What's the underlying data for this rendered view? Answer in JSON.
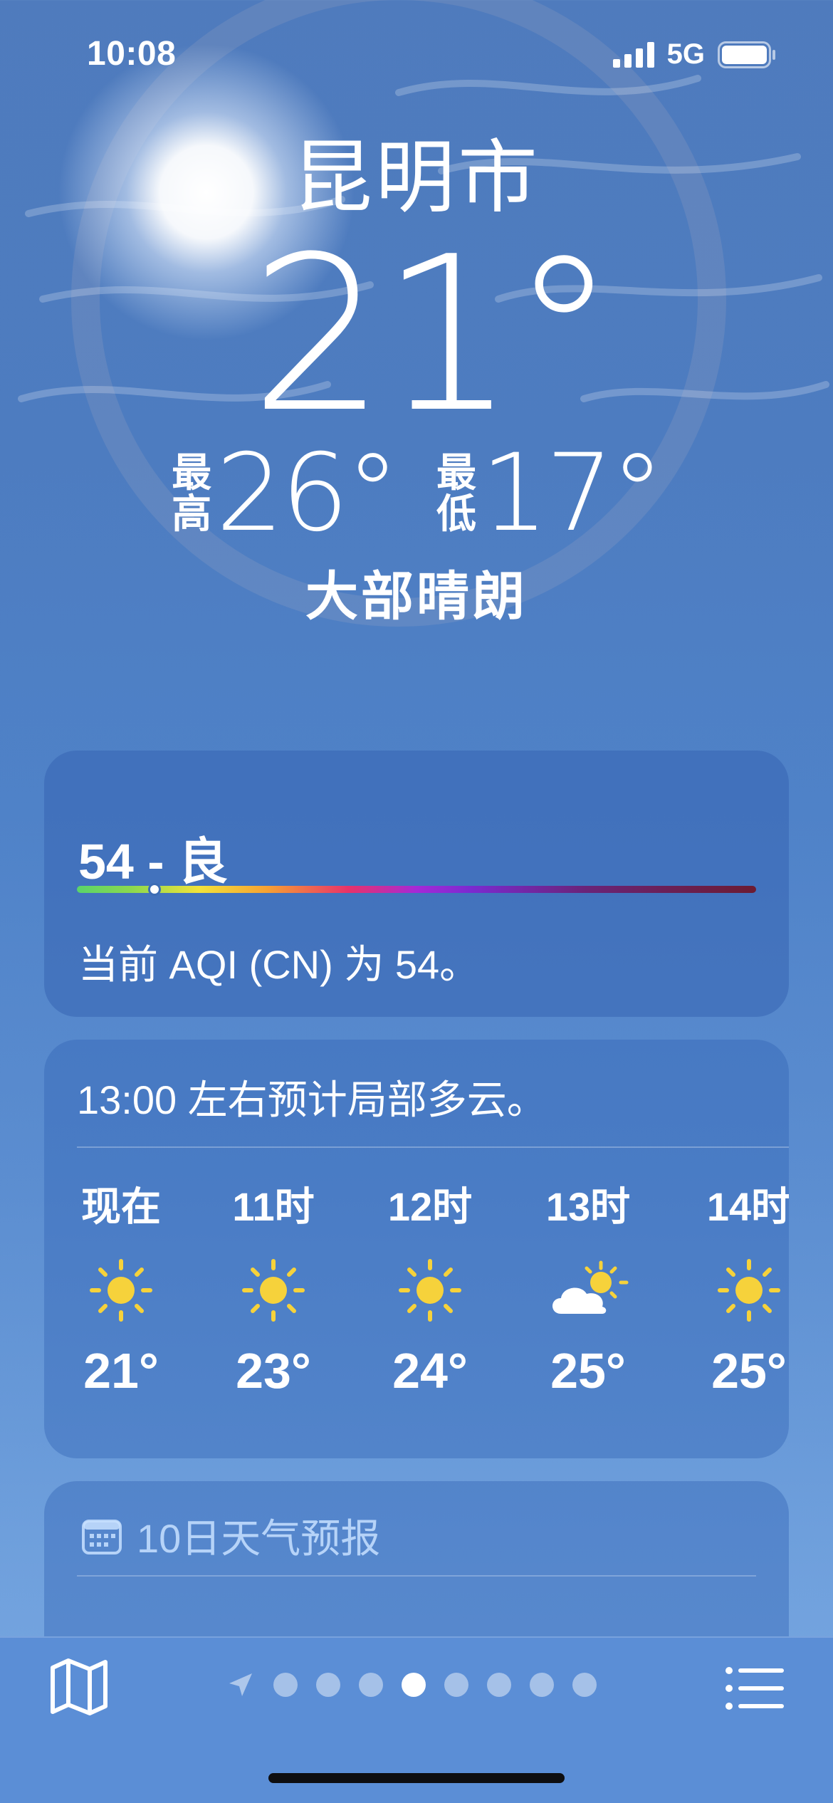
{
  "status_bar": {
    "time": "10:08",
    "network": "5G"
  },
  "weather": {
    "city": "昆明市",
    "current_temp": "21°",
    "high_label": [
      "最",
      "高"
    ],
    "high": "26°",
    "low_label": [
      "最",
      "低"
    ],
    "low": "17°",
    "condition": "大部晴朗"
  },
  "aqi": {
    "title": "54 - 良",
    "value": 54,
    "description": "当前 AQI (CN) 为 54。"
  },
  "hourly": {
    "summary": "13:00 左右预计局部多云。",
    "items": [
      {
        "label": "现在",
        "icon": "sun-icon",
        "temp": "21°"
      },
      {
        "label": "11时",
        "icon": "sun-icon",
        "temp": "23°"
      },
      {
        "label": "12时",
        "icon": "sun-icon",
        "temp": "24°"
      },
      {
        "label": "13时",
        "icon": "partly-cloudy-icon",
        "temp": "25°"
      },
      {
        "label": "14时",
        "icon": "sun-icon",
        "temp": "25°"
      }
    ]
  },
  "forecast": {
    "title": "10日天气预报"
  },
  "bottom_bar": {
    "page_count": 8,
    "active_page": 3
  },
  "colors": {
    "sun": "#f6d23b",
    "accent": "#5b8ed6"
  }
}
